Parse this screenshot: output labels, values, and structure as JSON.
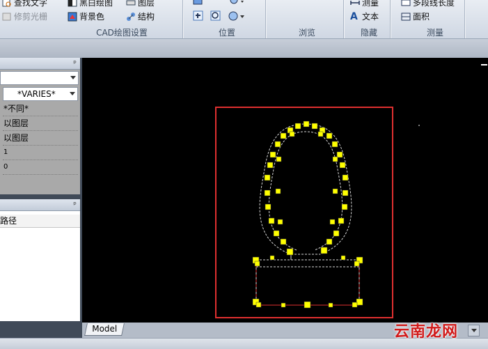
{
  "ribbon": {
    "row1": {
      "find_text": "查找文字",
      "black_white": "黑白绘图",
      "layer": "图层",
      "measure": "测量",
      "polyline_length": "多段线长度"
    },
    "row2": {
      "trim_light": "修剪光栅",
      "background": "背景色",
      "structure": "结构",
      "text": "文本",
      "area": "面积"
    },
    "groups": {
      "cad_settings": "CAD绘图设置",
      "position": "位置",
      "browse": "浏览",
      "hide": "隐藏",
      "measure": "测量"
    }
  },
  "properties_panel": {
    "pin": "ᵖ",
    "color_value": "*VARIES*",
    "rows": [
      "*不同*",
      "以图层",
      "以图层",
      "1",
      "0"
    ]
  },
  "layers_panel": {
    "pin": "ᵖ",
    "column_header": "路径"
  },
  "drawing": {
    "tab_model": "Model",
    "selection_color": "#e03030",
    "grip_color": "#ffff00"
  },
  "watermark": "云南龙网"
}
